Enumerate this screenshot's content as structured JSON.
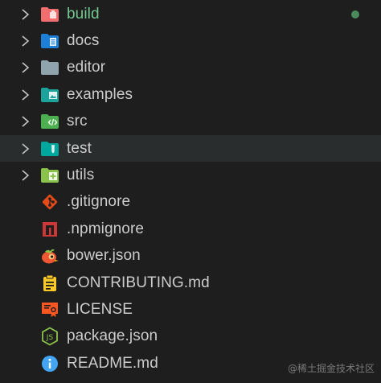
{
  "explorer": {
    "items": [
      {
        "label": "build",
        "type": "folder",
        "icon": "build-folder-icon",
        "color": "#f26d6d",
        "modified": true,
        "selected": false
      },
      {
        "label": "docs",
        "type": "folder",
        "icon": "docs-folder-icon",
        "color": "#1e7fd6",
        "modified": false,
        "selected": false
      },
      {
        "label": "editor",
        "type": "folder",
        "icon": "folder-icon",
        "color": "#90a4ae",
        "modified": false,
        "selected": false
      },
      {
        "label": "examples",
        "type": "folder",
        "icon": "examples-folder-icon",
        "color": "#1ba39c",
        "modified": false,
        "selected": false
      },
      {
        "label": "src",
        "type": "folder",
        "icon": "src-folder-icon",
        "color": "#4caf50",
        "modified": false,
        "selected": false
      },
      {
        "label": "test",
        "type": "folder",
        "icon": "test-folder-icon",
        "color": "#00a79d",
        "modified": false,
        "selected": true
      },
      {
        "label": "utils",
        "type": "folder",
        "icon": "utils-folder-icon",
        "color": "#8bc34a",
        "modified": false,
        "selected": false
      },
      {
        "label": ".gitignore",
        "type": "file",
        "icon": "git-icon",
        "color": "#e64a19"
      },
      {
        "label": ".npmignore",
        "type": "file",
        "icon": "npm-icon",
        "color": "#cb3837"
      },
      {
        "label": "bower.json",
        "type": "file",
        "icon": "bower-icon",
        "color": "#ef5734"
      },
      {
        "label": "CONTRIBUTING.md",
        "type": "file",
        "icon": "contributing-icon",
        "color": "#ffca28"
      },
      {
        "label": "LICENSE",
        "type": "file",
        "icon": "license-icon",
        "color": "#ff5722"
      },
      {
        "label": "package.json",
        "type": "file",
        "icon": "nodejs-icon",
        "color": "#8bc34a"
      },
      {
        "label": "README.md",
        "type": "file",
        "icon": "info-icon",
        "color": "#42a5f5"
      }
    ],
    "modified_dot_color": "#4b8a5c"
  },
  "watermark": "@稀土掘金技术社区"
}
